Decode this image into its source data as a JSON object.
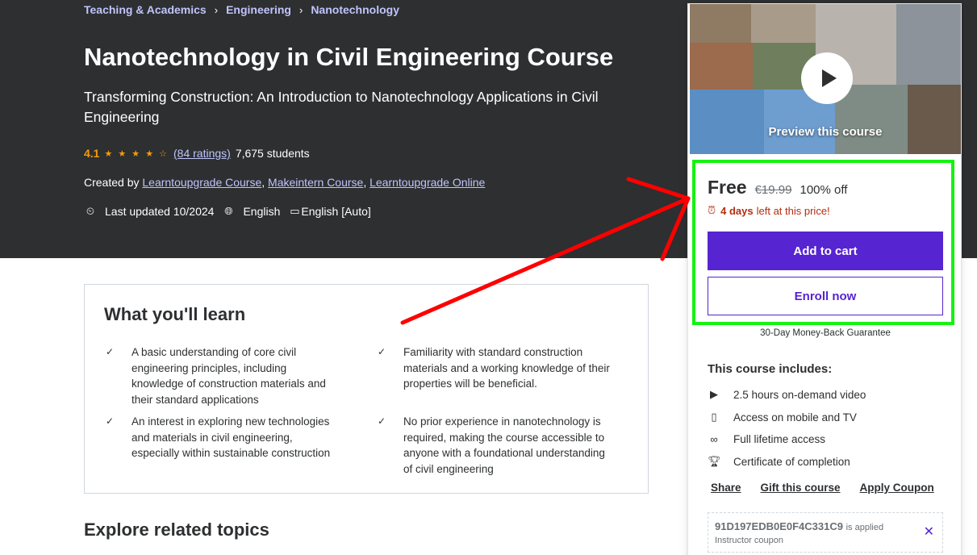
{
  "breadcrumb": {
    "items": [
      "Teaching & Academics",
      "Engineering",
      "Nanotechnology"
    ],
    "separator": "›"
  },
  "course": {
    "title": "Nanotechnology in Civil Engineering Course",
    "subtitle": "Transforming Construction: An Introduction to Nanotechnology Applications in Civil Engineering",
    "rating": "4.1",
    "stars": "★ ★ ★ ★ ☆",
    "ratings_count": "(84 ratings)",
    "students": "7,675 students",
    "created_by_label": "Created by",
    "authors": [
      "Learntoupgrade Course",
      "Makeintern Course",
      "Learntoupgrade Online"
    ],
    "last_updated": "Last updated 10/2024",
    "language": "English",
    "captions": "English [Auto]"
  },
  "learn": {
    "title": "What you'll learn",
    "items": [
      "A basic understanding of core civil engineering principles, including knowledge of construction materials and their standard applications",
      "Familiarity with standard construction materials and a working knowledge of their properties will be beneficial.",
      "An interest in exploring new technologies and materials in civil engineering, especially within sustainable construction",
      "No prior experience in nanotechnology is required, making the course accessible to anyone with a foundational understanding of civil engineering"
    ]
  },
  "explore": {
    "title": "Explore related topics"
  },
  "sidebar": {
    "preview_label": "Preview this course",
    "price": "Free",
    "original_price": "€19.99",
    "discount": "100% off",
    "timer_days": "4 days",
    "timer_rest": "left at this price!",
    "add_to_cart": "Add to cart",
    "enroll_now": "Enroll now",
    "guarantee": "30-Day Money-Back Guarantee",
    "includes_title": "This course includes:",
    "includes": [
      {
        "icon": "video-icon",
        "text": "2.5 hours on-demand video"
      },
      {
        "icon": "mobile-icon",
        "text": "Access on mobile and TV"
      },
      {
        "icon": "infinity-icon",
        "text": "Full lifetime access"
      },
      {
        "icon": "trophy-icon",
        "text": "Certificate of completion"
      }
    ],
    "links": [
      "Share",
      "Gift this course",
      "Apply Coupon"
    ],
    "coupon_code": "91D197EDB0E0F4C331C9",
    "coupon_applied": "is applied",
    "coupon_type": "Instructor coupon"
  },
  "colors": {
    "hero_bg": "#2d2f31",
    "brand_purple": "#5624d0",
    "link_lavender": "#c0c4fc",
    "star_orange": "#f69c08",
    "timer_red": "#b32d0f",
    "annotation_green": "#16f212",
    "annotation_red": "#ff0000"
  }
}
